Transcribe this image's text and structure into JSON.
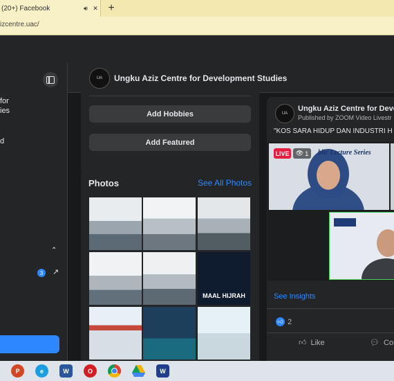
{
  "browser": {
    "tab_title": "(20+) Facebook",
    "mute_icon": "speaker-icon",
    "close_glyph": "✕",
    "new_tab_glyph": "+",
    "address": "izcentre.uac/"
  },
  "sidebar": {
    "partial_lines": [
      "for",
      "ies",
      "d"
    ],
    "badge_count": "3",
    "chevron_glyph": "⌃",
    "external_glyph": "↗"
  },
  "page": {
    "name": "Ungku Aziz Centre for Development Studies"
  },
  "profile_actions": {
    "add_hobbies": "Add Hobbies",
    "add_featured": "Add Featured"
  },
  "photos": {
    "title": "Photos",
    "see_all": "See All Photos",
    "tile_texts": [
      "",
      "",
      "",
      "",
      "",
      "MAAL HIJRAH",
      "",
      "",
      ""
    ]
  },
  "post": {
    "page_name": "Ungku Aziz Centre for Develo",
    "published": "Published by ZOOM Video Livestr",
    "quote": "\"KOS SARA HIDUP DAN INDUSTRI H",
    "live_label": "LIVE",
    "viewer_count": "1",
    "video_banner": "blic Lecture Series",
    "see_insights": "See Insights",
    "like_count": "2",
    "like_label": "Like",
    "comment_label": "Com"
  },
  "taskbar": {
    "apps": [
      "powerpoint",
      "edge",
      "word",
      "opera",
      "chrome",
      "drive",
      "webex"
    ]
  },
  "colors": {
    "accent": "#2d88ff",
    "live": "#e41e3f",
    "surface": "#242526",
    "background": "#18191a"
  }
}
